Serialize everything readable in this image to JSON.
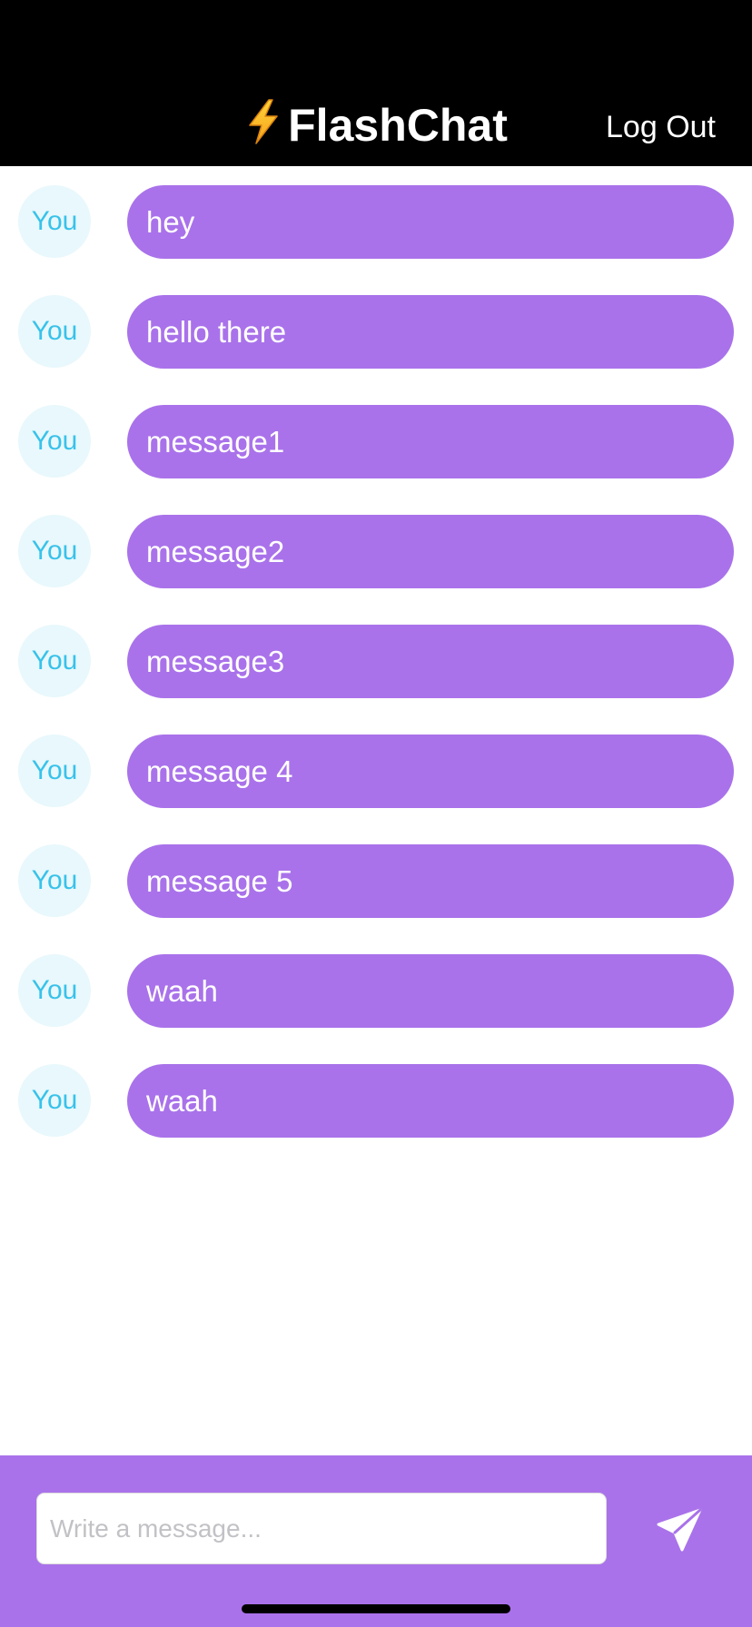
{
  "header": {
    "title": "FlashChat",
    "title_icon": "lightning-bolt-icon",
    "logout_label": "Log Out"
  },
  "messages": [
    {
      "sender": "You",
      "text": "hey"
    },
    {
      "sender": "You",
      "text": "hello there"
    },
    {
      "sender": "You",
      "text": "message1"
    },
    {
      "sender": "You",
      "text": "message2"
    },
    {
      "sender": "You",
      "text": "message3"
    },
    {
      "sender": "You",
      "text": "message 4"
    },
    {
      "sender": "You",
      "text": "message 5"
    },
    {
      "sender": "You",
      "text": "waah"
    },
    {
      "sender": "You",
      "text": "waah"
    }
  ],
  "composer": {
    "placeholder": "Write a message...",
    "value": "",
    "send_icon": "paper-plane-icon"
  },
  "colors": {
    "header_bg": "#000000",
    "bubble": "#a972ea",
    "avatar_bg": "#e8f8fc",
    "avatar_text": "#38c2ea",
    "composer_bg": "#a972ea"
  }
}
